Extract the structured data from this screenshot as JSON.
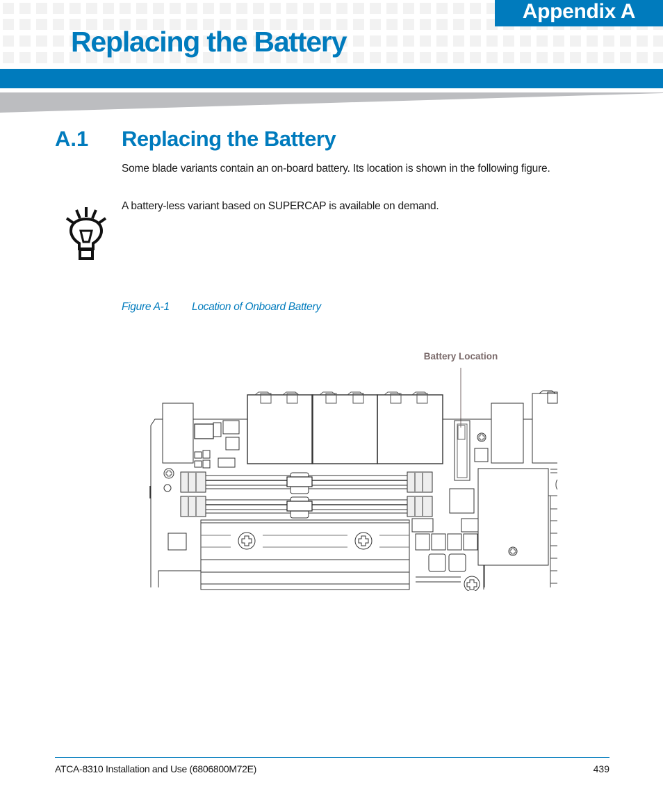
{
  "header": {
    "appendix_label": "Appendix A",
    "chapter_title": "Replacing the Battery",
    "brand_color": "#007bbd",
    "wedge_color": "#bcbdc0",
    "grid_color": "#f2f2f2"
  },
  "section": {
    "number": "A.1",
    "title": "Replacing the Battery",
    "intro": "Some blade variants contain an on-board battery. Its location is shown in the following figure."
  },
  "note": {
    "icon": "lightbulb-icon",
    "text": "A battery-less variant based on SUPERCAP is available on demand."
  },
  "figure": {
    "number": "Figure A-1",
    "title": "Location of Onboard Battery",
    "callout_label": "Battery Location",
    "callout_color": "#7a6a6a"
  },
  "footer": {
    "document": "ATCA-8310 Installation and Use (6806800M72E)",
    "page_number": "439"
  }
}
